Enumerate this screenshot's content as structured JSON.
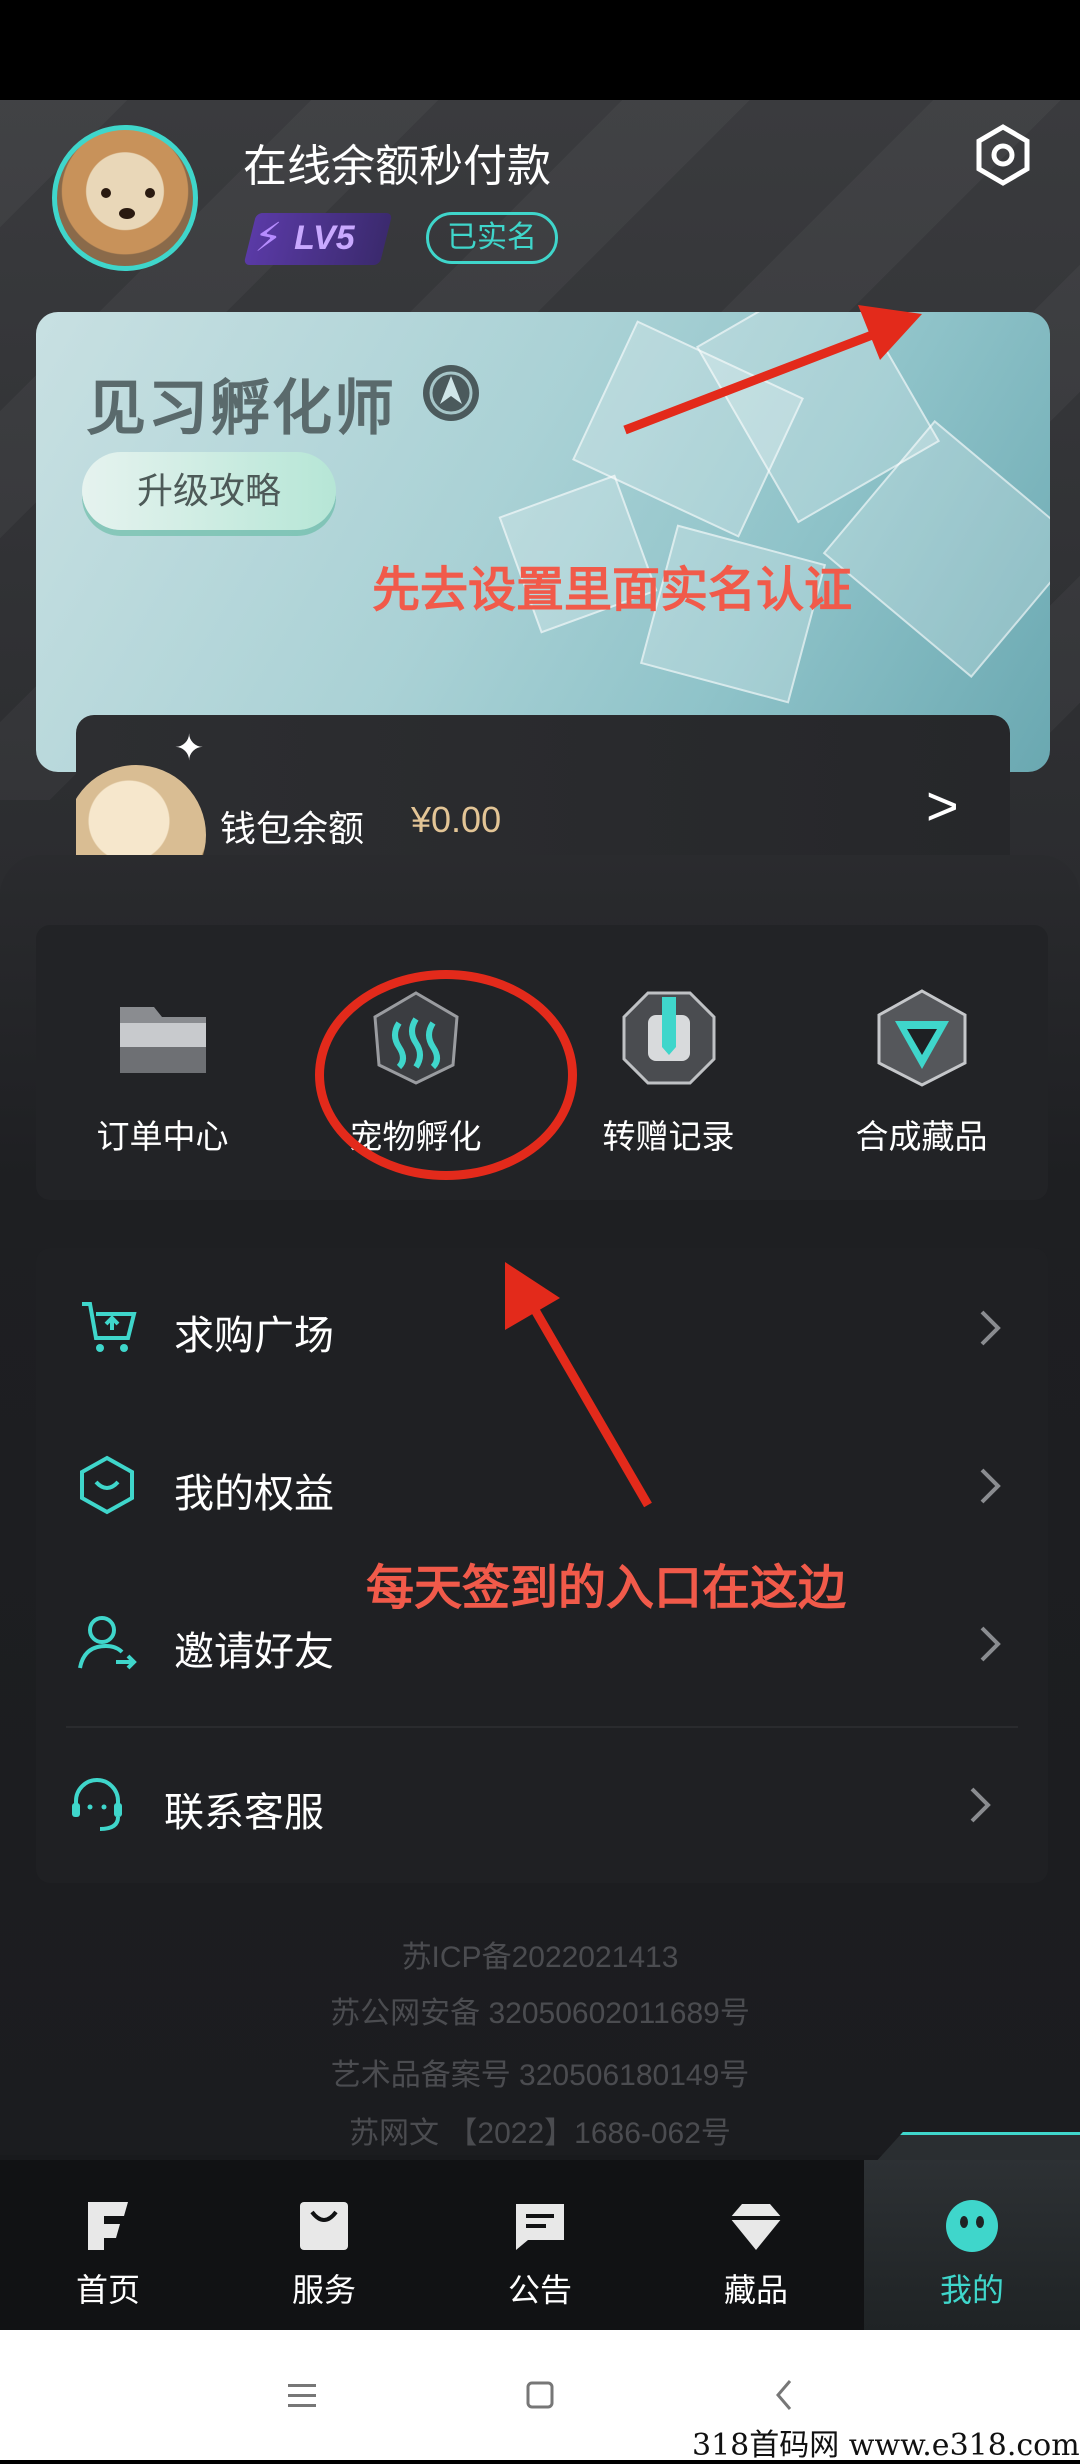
{
  "profile": {
    "username": "在线余额秒付款",
    "level": "LV5",
    "verified_badge": "已实名"
  },
  "banner": {
    "title": "见习孵化师",
    "upgrade_button": "升级攻略"
  },
  "wallet": {
    "label": "钱包余额",
    "amount": "¥0.00",
    "arrow": ">"
  },
  "quick_actions": [
    {
      "label": "订单中心",
      "icon": "folder-icon"
    },
    {
      "label": "宠物孵化",
      "icon": "hatch-icon"
    },
    {
      "label": "转赠记录",
      "icon": "transfer-icon"
    },
    {
      "label": "合成藏品",
      "icon": "synthesize-icon"
    }
  ],
  "menu": [
    {
      "label": "求购广场",
      "icon": "cart-icon"
    },
    {
      "label": "我的权益",
      "icon": "rights-icon"
    },
    {
      "label": "邀请好友",
      "icon": "invite-icon"
    },
    {
      "label": "联系客服",
      "icon": "headset-icon"
    }
  ],
  "footer": [
    "苏ICP备2022021413",
    "苏公网安备 32050602011689号",
    "艺术品备案号 320506180149号",
    "苏网文 【2022】1686-062号"
  ],
  "tabs": [
    {
      "label": "首页",
      "icon": "home-icon"
    },
    {
      "label": "服务",
      "icon": "bag-icon"
    },
    {
      "label": "公告",
      "icon": "message-icon"
    },
    {
      "label": "藏品",
      "icon": "gem-icon"
    },
    {
      "label": "我的",
      "icon": "mascot-icon",
      "active": true
    }
  ],
  "annotations": {
    "settings_hint": "先去设置里面实名认证",
    "checkin_hint": "每天签到的入口在这边"
  },
  "watermark": "318首码网  www.e318.com",
  "colors": {
    "accent": "#3fd6cb",
    "annotation_red": "#f15a4a",
    "wallet_amount": "#e3c596"
  }
}
